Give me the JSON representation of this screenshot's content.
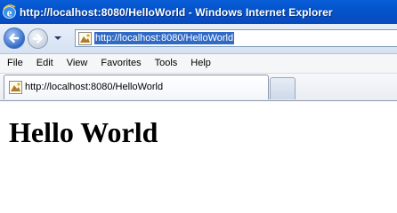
{
  "window": {
    "title": "http://localhost:8080/HelloWorld - Windows Internet Explorer",
    "icon": "ie-icon"
  },
  "navigation": {
    "back_icon": "back-arrow-icon",
    "forward_icon": "forward-arrow-icon",
    "address_value": "http://localhost:8080/HelloWorld"
  },
  "menu": {
    "items": [
      "File",
      "Edit",
      "View",
      "Favorites",
      "Tools",
      "Help"
    ]
  },
  "tabs": [
    {
      "label": "http://localhost:8080/HelloWorld",
      "icon": "page-icon"
    }
  ],
  "content": {
    "heading": "Hello World"
  },
  "colors": {
    "titlebar": "#0a5ed8",
    "selection": "#316ac5"
  }
}
